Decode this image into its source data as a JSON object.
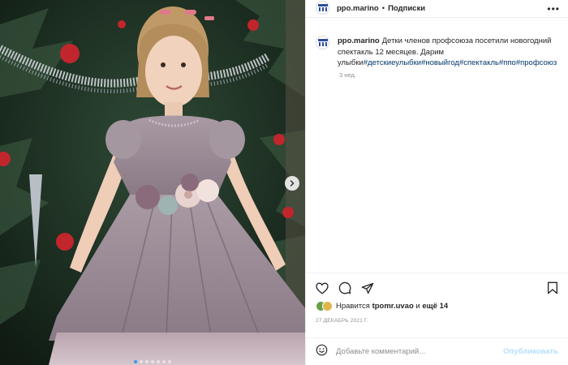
{
  "header": {
    "username": "ppo.marino",
    "separator": "•",
    "follow_label": "Подписки",
    "more_label": "•••"
  },
  "post": {
    "caption_username": "ppo.marino",
    "caption_text": "Детки членов профсоюза посетили новогодний спектакль 12 месяцев. Дарим улыбки",
    "hashtags": [
      "#детскиеулыбки",
      "#новыйгод",
      "#спектакль",
      "#ппо",
      "#профсоюз"
    ],
    "time_ago": "3 нед."
  },
  "actions": {
    "liked_by_prefix": "Нравится",
    "liked_by_user": "tpomr.uvao",
    "liked_by_and": "и",
    "liked_by_rest": "ещё 14",
    "date": "27 ДЕКАБРЬ 2021 Г."
  },
  "comment": {
    "placeholder": "Добавьте комментарий...",
    "publish_label": "Опубликовать"
  },
  "carousel": {
    "total_slides": 7,
    "active_slide": 1
  },
  "colors": {
    "accent": "#0095f6",
    "link": "#00376b",
    "muted": "#8e8e8e",
    "publish_disabled": "#b2dffc"
  }
}
